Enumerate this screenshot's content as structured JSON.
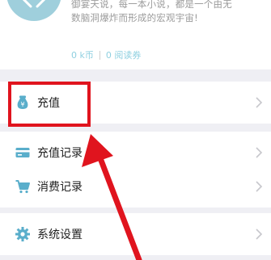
{
  "profile": {
    "bio_line1": "御宴天说，每一本小说，都是一个由无",
    "bio_line2": "数脑洞爆炸而形成的宏观宇宙!",
    "coins": "0 k币",
    "reading_vouchers": "0 阅读券"
  },
  "menu": [
    {
      "label": "充值",
      "icon": "money-bag-icon"
    },
    {
      "label": "充值记录",
      "icon": "card-icon"
    },
    {
      "label": "消费记录",
      "icon": "cart-icon"
    },
    {
      "label": "系统设置",
      "icon": "gear-icon"
    }
  ],
  "colors": {
    "accent_blue": "#5aaecb",
    "highlight_red": "#e0141e",
    "background": "#efeff4"
  }
}
